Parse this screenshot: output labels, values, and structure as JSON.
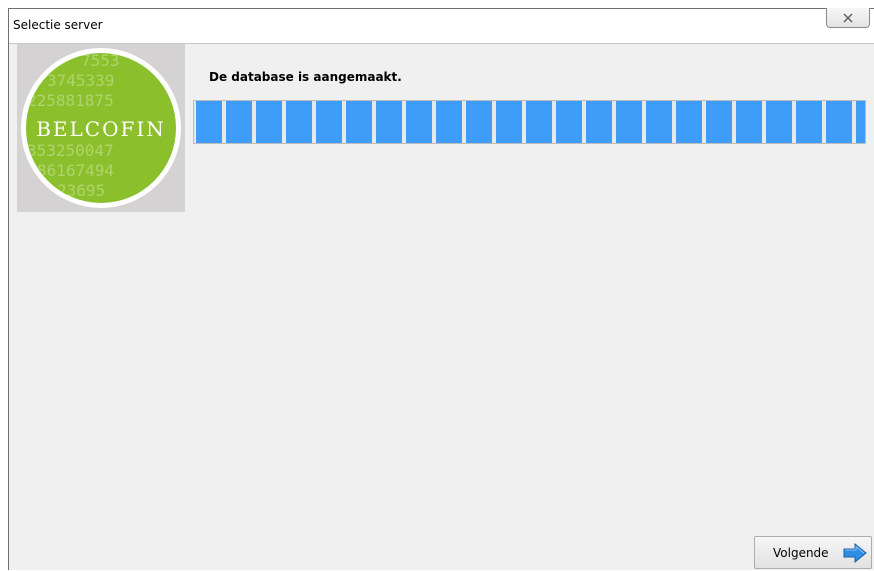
{
  "window": {
    "title": "Selectie server"
  },
  "logo": {
    "text": "BELCOFIN",
    "background_color": "#8bbf2c",
    "digits_rows": [
      "7553",
      "3745339",
      "225881875",
      "BELCOFIN",
      "353250047",
      "86167494",
      "23695"
    ]
  },
  "main": {
    "message": "De database is aangemaakt.",
    "progress": {
      "value": 1.0,
      "color": "#3f9dfa"
    }
  },
  "footer": {
    "next_label": "Volgende",
    "next_icon": "arrow-right-icon"
  },
  "icons": {
    "close": "close-icon"
  }
}
